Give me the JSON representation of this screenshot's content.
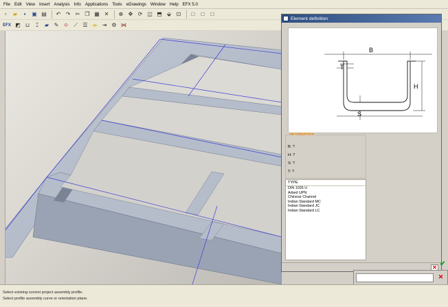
{
  "menu": {
    "items": [
      "File",
      "Edit",
      "View",
      "Insert",
      "Analysis",
      "Info",
      "Applications",
      "Tools",
      "eDrawings",
      "Window",
      "Help",
      "EFX 5.0"
    ]
  },
  "toolbar1": {
    "icons": [
      "new-icon",
      "open-icon",
      "save-icon",
      "save-as-icon",
      "print-icon",
      "undo-icon",
      "redo-icon",
      "cut-icon",
      "copy-icon",
      "paste-icon",
      "delete-icon",
      "zoom-icon",
      "pan-icon",
      "rotate-icon",
      "view-front-icon",
      "view-top-icon",
      "view-iso-icon",
      "view-fit-icon"
    ]
  },
  "toolbar2": {
    "logo": "EFX",
    "icons": [
      "profile-icon",
      "channel-icon",
      "beam-icon",
      "plate-icon",
      "weld-icon",
      "joint-icon",
      "miter-icon",
      "cut-list-icon",
      "trim-icon",
      "extend-icon",
      "bolt-icon",
      "connection-icon"
    ]
  },
  "dialog": {
    "title": "Element definition",
    "diagram_labels": {
      "b": "B",
      "t": "T",
      "h": "H",
      "s": "S"
    },
    "information": {
      "legend": "INFORMATION",
      "b": "B: ?",
      "h": "H: ?",
      "s": "S: ?",
      "t": "T: ?"
    },
    "type_list": {
      "header": "TYPE",
      "items": [
        "DIN 1026 U",
        "Arbed UPN",
        "Chinese Channel",
        "Indian Standard MC",
        "Indian Standard JC",
        "Indian Standard LC"
      ]
    },
    "close_symbol": "✕"
  },
  "panel2": {
    "close_symbol": "✕",
    "ok_symbol": "✔"
  },
  "status": {
    "line1": "Select existing current project assembly profile.",
    "line2": "Select profile assembly curve or orientation plane."
  },
  "colors": {
    "frame_fill": "#aab4c6",
    "frame_shadow": "#6d7686",
    "sketch_line": "#3b3bd6",
    "info_legend": "#e08a1a",
    "close_red": "#d10000"
  }
}
